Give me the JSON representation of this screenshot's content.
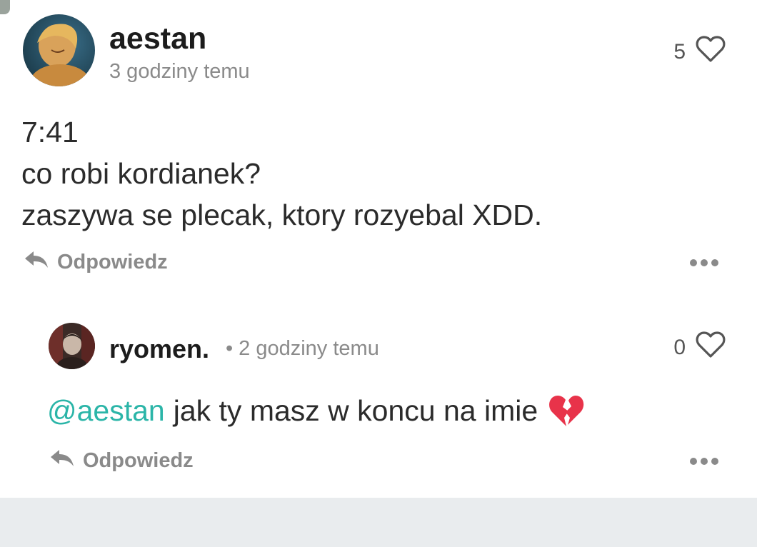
{
  "post": {
    "username": "aestan",
    "timestamp": "3 godziny temu",
    "likes": "5",
    "lines": [
      "7:41",
      "co robi kordianek?",
      "zaszywa se plecak, ktory rozyebal XDD."
    ],
    "reply_label": "Odpowiedz"
  },
  "reply": {
    "username": "ryomen.",
    "separator": "•",
    "timestamp": "2 godziny temu",
    "likes": "0",
    "mention": "@aestan",
    "text": "jak ty masz w koncu na imie",
    "emoji_icon": "broken-heart-icon",
    "reply_label": "Odpowiedz"
  },
  "colors": {
    "mention": "#2bb5a8",
    "muted": "#8a8a8a",
    "footer": "#e9ecee"
  }
}
